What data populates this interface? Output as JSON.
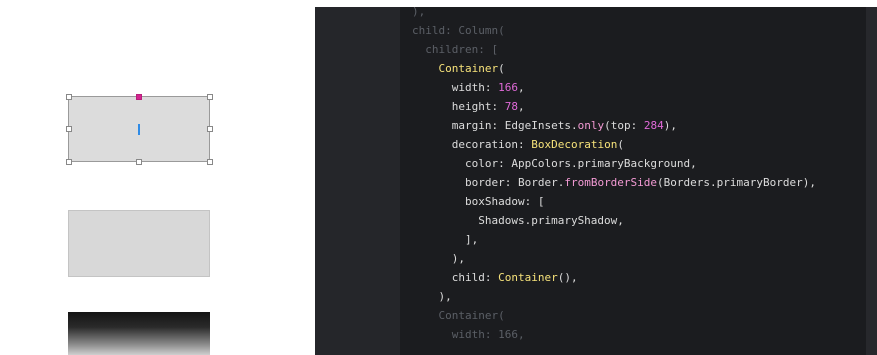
{
  "colors": {
    "editor_bg": "#1b1c1f",
    "class_color": "#f6e27a",
    "number_color": "#e06ad8",
    "method_color": "#f39ad4",
    "dim_color": "#5b5f66",
    "selection_handle_accent": "#d3248f",
    "cursor_color": "#2f8be6"
  },
  "icons": {
    "resize_handle": "square-handle-icon",
    "accent_handle": "magenta-handle-icon",
    "text_cursor": "text-cursor-icon"
  },
  "code": {
    "lines": [
      {
        "parts": [
          {
            "text": "),",
            "cls": "dim"
          }
        ]
      },
      {
        "parts": [
          {
            "text": "child: Column(",
            "cls": "dim"
          }
        ]
      },
      {
        "parts": [
          {
            "text": "  children: [",
            "cls": "dim"
          }
        ]
      },
      {
        "parts": [
          {
            "text": "    ",
            "cls": "base"
          },
          {
            "text": "Container",
            "cls": "cls"
          },
          {
            "text": "(",
            "cls": "base"
          }
        ]
      },
      {
        "parts": [
          {
            "text": "      width: ",
            "cls": "base"
          },
          {
            "text": "166",
            "cls": "num"
          },
          {
            "text": ",",
            "cls": "base"
          }
        ]
      },
      {
        "parts": [
          {
            "text": "      height: ",
            "cls": "base"
          },
          {
            "text": "78",
            "cls": "num"
          },
          {
            "text": ",",
            "cls": "base"
          }
        ]
      },
      {
        "parts": [
          {
            "text": "      margin: EdgeInsets.",
            "cls": "base"
          },
          {
            "text": "only",
            "cls": "meth"
          },
          {
            "text": "(top: ",
            "cls": "base"
          },
          {
            "text": "284",
            "cls": "num"
          },
          {
            "text": "),",
            "cls": "base"
          }
        ]
      },
      {
        "parts": [
          {
            "text": "      decoration: ",
            "cls": "base"
          },
          {
            "text": "BoxDecoration",
            "cls": "cls"
          },
          {
            "text": "(",
            "cls": "base"
          }
        ]
      },
      {
        "parts": [
          {
            "text": "        color: AppColors.primaryBackground,",
            "cls": "base"
          }
        ]
      },
      {
        "parts": [
          {
            "text": "        border: Border.",
            "cls": "base"
          },
          {
            "text": "fromBorderSide",
            "cls": "meth"
          },
          {
            "text": "(Borders.primaryBorder),",
            "cls": "base"
          }
        ]
      },
      {
        "parts": [
          {
            "text": "        boxShadow: [",
            "cls": "base"
          }
        ]
      },
      {
        "parts": [
          {
            "text": "          Shadows.primaryShadow,",
            "cls": "base"
          }
        ]
      },
      {
        "parts": [
          {
            "text": "        ],",
            "cls": "base"
          }
        ]
      },
      {
        "parts": [
          {
            "text": "      ),",
            "cls": "base"
          }
        ]
      },
      {
        "parts": [
          {
            "text": "      child: ",
            "cls": "base"
          },
          {
            "text": "Container",
            "cls": "cls"
          },
          {
            "text": "(),",
            "cls": "base"
          }
        ]
      },
      {
        "parts": [
          {
            "text": "    ),",
            "cls": "base"
          }
        ]
      },
      {
        "parts": [
          {
            "text": "    Container(",
            "cls": "dim"
          }
        ]
      },
      {
        "parts": [
          {
            "text": "      width: 166,",
            "cls": "dim"
          }
        ]
      }
    ]
  }
}
